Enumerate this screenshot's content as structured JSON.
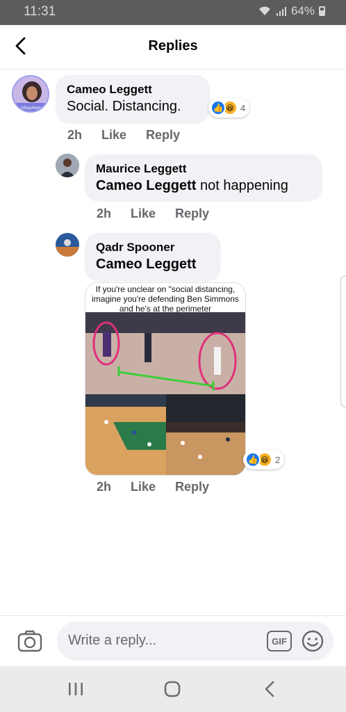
{
  "status_bar": {
    "time": "11:31",
    "battery": "64%"
  },
  "header": {
    "title": "Replies"
  },
  "comments": [
    {
      "author": "Cameo Leggett",
      "text": "Social. Distancing.",
      "time": "2h",
      "like": "Like",
      "reply": "Reply",
      "reaction_count": "4",
      "avatar_badge": "#StayHome"
    },
    {
      "author": "Maurice Leggett",
      "mention": "Cameo Leggett",
      "text": " not happening",
      "time": "2h",
      "like": "Like",
      "reply": "Reply"
    },
    {
      "author": "Qadr Spooner",
      "mention": "Cameo Leggett",
      "time": "2h",
      "like": "Like",
      "reply": "Reply",
      "reaction_count": "2",
      "image_caption": "If you're unclear on \"social distancing, imagine you're defending Ben Simmons and he's at the perimeter"
    }
  ],
  "composer": {
    "placeholder": "Write a reply...",
    "gif_label": "GIF"
  },
  "colors": {
    "bubble": "#f0f2f5",
    "like_blue": "#1877f2",
    "haha_yellow": "#f7b125",
    "meta_gray": "#65676b"
  },
  "icons": [
    "back-arrow-icon",
    "like-reaction-icon",
    "haha-reaction-icon",
    "camera-icon",
    "gif-icon",
    "emoji-icon",
    "recent-apps-icon",
    "home-icon",
    "nav-back-icon"
  ]
}
